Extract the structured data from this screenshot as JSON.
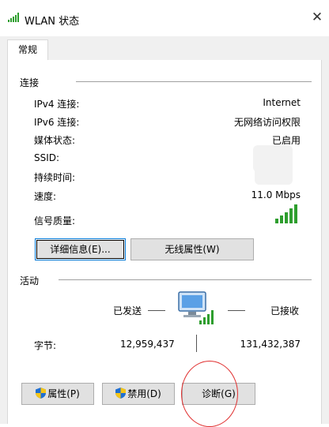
{
  "window": {
    "title": "WLAN 状态",
    "icons": {
      "title": "signal-bars-icon",
      "close": "close-icon"
    }
  },
  "tabs": [
    {
      "label": "常规"
    }
  ],
  "connection": {
    "section_label": "连接",
    "rows": [
      {
        "label": "IPv4 连接:",
        "value": "Internet"
      },
      {
        "label": "IPv6 连接:",
        "value": "无网络访问权限"
      },
      {
        "label": "媒体状态:",
        "value": "已启用"
      },
      {
        "label": "SSID:",
        "value": ""
      },
      {
        "label": "持续时间:",
        "value": ""
      },
      {
        "label": "速度:",
        "value": "11.0 Mbps"
      },
      {
        "label": "信号质量:",
        "value": ""
      }
    ],
    "signal_quality_bars": 5,
    "buttons": {
      "details": "详细信息(E)...",
      "wireless_properties": "无线属性(W)"
    }
  },
  "activity": {
    "section_label": "活动",
    "sent_label": "已发送",
    "received_label": "已接收",
    "bytes_label": "字节:",
    "bytes_sent": "12,959,437",
    "bytes_received": "131,432,387",
    "icon": "network-computer-icon"
  },
  "bottom_buttons": {
    "properties": "属性(P)",
    "disable": "禁用(D)",
    "diagnose": "诊断(G)"
  },
  "colors": {
    "accent": "#0078d7",
    "signal_green": "#2e9e2e",
    "annotation_red": "#e03030"
  }
}
